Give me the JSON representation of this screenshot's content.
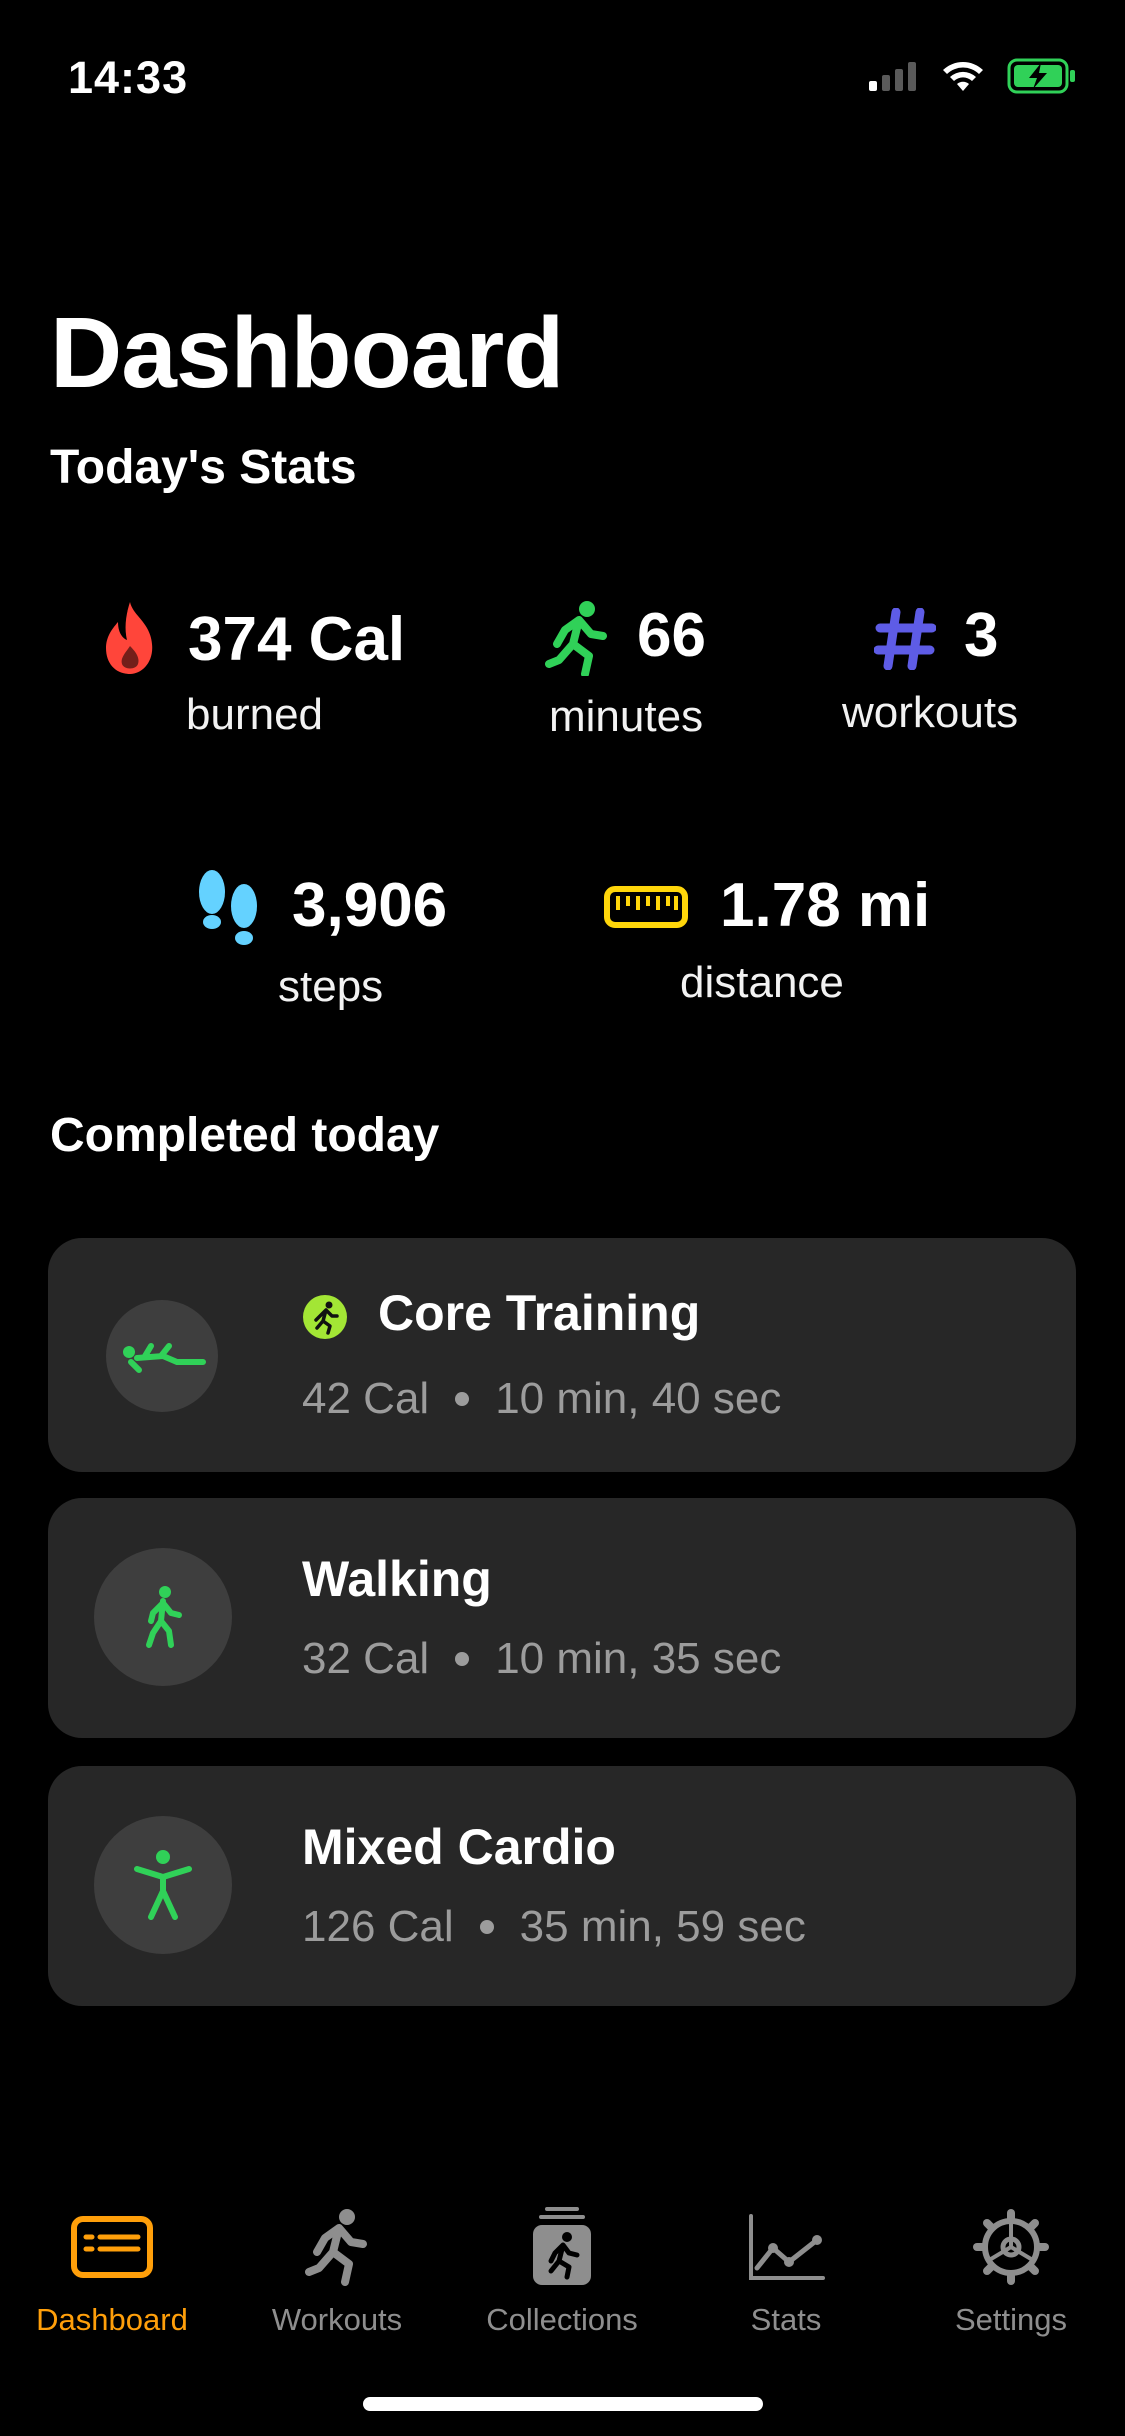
{
  "status_bar": {
    "time": "14:33"
  },
  "header": {
    "title": "Dashboard",
    "subtitle": "Today's Stats"
  },
  "stats": [
    {
      "id": "calories",
      "value": "374 Cal",
      "label": "burned",
      "icon": "flame-icon",
      "color": "#ff453a"
    },
    {
      "id": "minutes",
      "value": "66",
      "label": "minutes",
      "icon": "running-figure-icon",
      "color": "#30d158"
    },
    {
      "id": "workouts",
      "value": "3",
      "label": "workouts",
      "icon": "hash-icon",
      "color": "#5e5ce6"
    },
    {
      "id": "steps",
      "value": "3,906",
      "label": "steps",
      "icon": "footprints-icon",
      "color": "#64d2ff"
    },
    {
      "id": "distance",
      "value": "1.78 mi",
      "label": "distance",
      "icon": "ruler-icon",
      "color": "#ffd60a"
    }
  ],
  "completed": {
    "title": "Completed today",
    "workouts": [
      {
        "name": "Core Training",
        "calories": "42 Cal",
        "duration": "10 min, 40 sec",
        "icon": "core-training-icon",
        "badge": "running-badge-icon"
      },
      {
        "name": "Walking",
        "calories": "32 Cal",
        "duration": "10 min, 35 sec",
        "icon": "walking-figure-icon"
      },
      {
        "name": "Mixed Cardio",
        "calories": "126 Cal",
        "duration": "35 min, 59 sec",
        "icon": "cardio-figure-icon"
      }
    ]
  },
  "tabs": [
    {
      "label": "Dashboard",
      "icon": "dashboard-icon",
      "active": true
    },
    {
      "label": "Workouts",
      "icon": "running-figure-icon",
      "active": false
    },
    {
      "label": "Collections",
      "icon": "collections-icon",
      "active": false
    },
    {
      "label": "Stats",
      "icon": "chart-line-icon",
      "active": false
    },
    {
      "label": "Settings",
      "icon": "gear-icon",
      "active": false
    }
  ],
  "colors": {
    "accent": "#ff9f0a",
    "green": "#30d158",
    "card": "#272727",
    "badge": "#a3e635"
  }
}
